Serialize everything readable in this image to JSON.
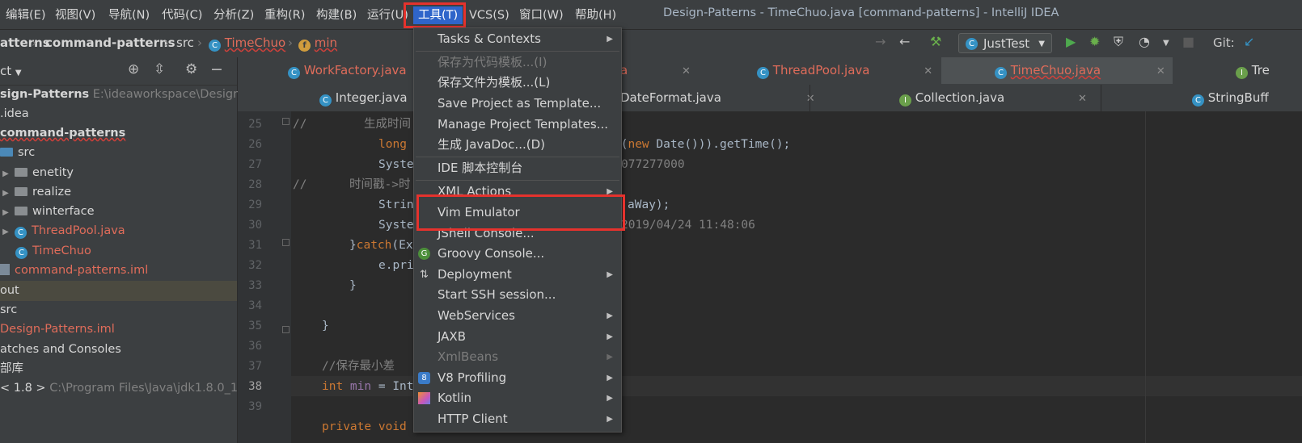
{
  "menubar": {
    "items": [
      "编辑(E)",
      "视图(V)",
      "导航(N)",
      "代码(C)",
      "分析(Z)",
      "重构(R)",
      "构建(B)",
      "运行(U)",
      "工具(T)",
      "VCS(S)",
      "窗口(W)",
      "帮助(H)"
    ],
    "title": "Design-Patterns - TimeChuo.java [command-patterns] - IntelliJ IDEA"
  },
  "breadcrumbs": [
    "atterns",
    "command-patterns",
    "src",
    "TimeChuo",
    "min"
  ],
  "toolbar": {
    "run_config": "JustTest",
    "git_label": "Git:"
  },
  "sidebar": {
    "header_label": "ct",
    "rows": [
      {
        "text": "sign-Patterns",
        "path": "E:\\ideaworkspace\\Design-"
      },
      {
        "text": ".idea"
      },
      {
        "text": "command-patterns"
      },
      {
        "text": "src"
      },
      {
        "text": "enetity"
      },
      {
        "text": "realize"
      },
      {
        "text": "winterface"
      },
      {
        "text": "ThreadPool.java"
      },
      {
        "text": "TimeChuo"
      },
      {
        "text": "command-patterns.iml"
      },
      {
        "text": "out"
      },
      {
        "text": "src"
      },
      {
        "text": "Design-Patterns.iml"
      },
      {
        "text": "atches and Consoles"
      },
      {
        "text": "部库"
      },
      {
        "text": "< 1.8 >",
        "path": "C:\\Program Files\\Java\\jdk1.8.0_1"
      }
    ]
  },
  "tabs_row1": [
    "WorkFactory.java",
    "a",
    "ThreadPool.java",
    "TimeChuo.java",
    "Tre"
  ],
  "tabs_row2": [
    "Integer.java",
    "DateFormat.java",
    "Collection.java",
    "StringBuff"
  ],
  "editor": {
    "line_numbers": [
      "25",
      "26",
      "27",
      "28",
      "29",
      "30",
      "31",
      "32",
      "33",
      "34",
      "35",
      "36",
      "37",
      "38",
      "39"
    ],
    "lines": {
      "l25a": "//",
      "l25b": "生成时间",
      "l26a": "long",
      "l26b": "t(",
      "l26c": "new",
      "l26d": " Date())).getTime();",
      "l27a": "Syste",
      "l27b": "077277000",
      "l28a": "//",
      "l28b": "时间戳->时",
      "l29a": "Strin",
      "l29b": "aWay);",
      "l30a": "Syste",
      "l30b": "2019/04/24 11:48:06",
      "l31a": "}",
      "l31b": "catch",
      "l31c": "(Ex",
      "l32": "e.pri",
      "l33": "}",
      "l35": "}",
      "l37": "//保存最小差",
      "l38a": "int",
      "l38b": " min",
      "l38c": " = Int",
      "l39": "private void ..."
    }
  },
  "dropdown": {
    "items": [
      {
        "label": "Tasks & Contexts",
        "sub": true
      },
      {
        "label": "保存为代码模板...(I)",
        "disabled": true
      },
      {
        "label": "保存文件为模板...(L)"
      },
      {
        "label": "Save Project as Template..."
      },
      {
        "label": "Manage Project Templates..."
      },
      {
        "label": "生成 JavaDoc...(D)"
      },
      {
        "label": "IDE 脚本控制台"
      },
      {
        "label": "XML Actions",
        "sub": true
      },
      {
        "label": "Vim Emulator"
      },
      {
        "label": "JShell Console..."
      },
      {
        "label": "Groovy Console..."
      },
      {
        "label": "Deployment",
        "sub": true
      },
      {
        "label": "Start SSH session..."
      },
      {
        "label": "WebServices",
        "sub": true
      },
      {
        "label": "JAXB",
        "sub": true
      },
      {
        "label": "XmlBeans",
        "sub": true,
        "disabled": true
      },
      {
        "label": "V8 Profiling",
        "sub": true
      },
      {
        "label": "Kotlin",
        "sub": true
      },
      {
        "label": "HTTP Client",
        "sub": true
      }
    ]
  },
  "colors": {
    "highlight": "#e5322d",
    "menu_active": "#2f65ca"
  }
}
